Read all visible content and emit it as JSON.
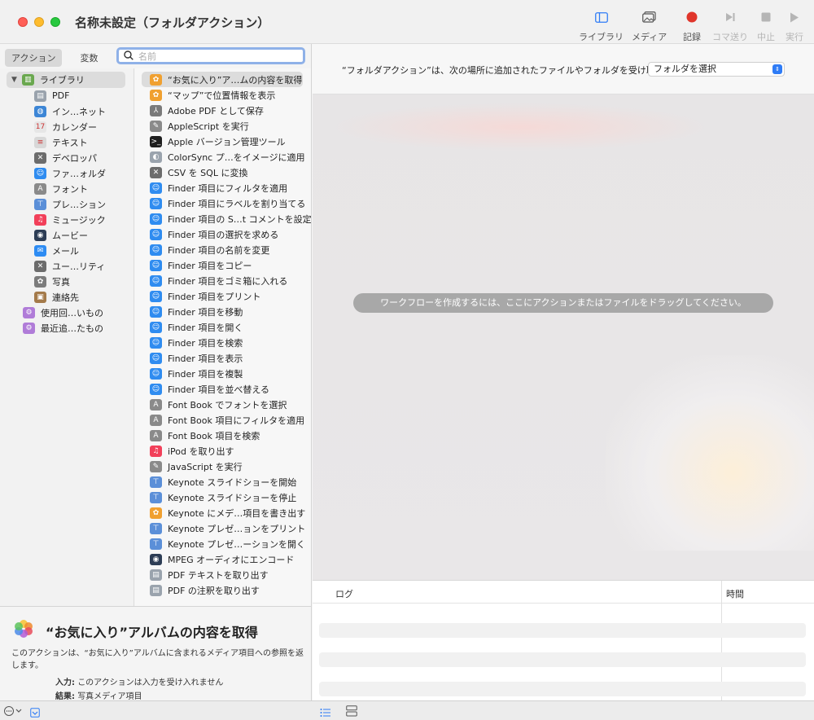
{
  "window": {
    "title": "名称未設定（フォルダアクション）"
  },
  "toolbar": {
    "library": "ライブラリ",
    "media": "メディア",
    "record": "記録",
    "step": "コマ送り",
    "stop": "中止",
    "run": "実行"
  },
  "tabs": {
    "actions": "アクション",
    "variables": "変数"
  },
  "search": {
    "placeholder": "名前"
  },
  "library": {
    "root": "ライブラリ",
    "items": [
      {
        "label": "PDF",
        "icon": "pdf-icon",
        "color": "#9aa3ad"
      },
      {
        "label": "イン…ネット",
        "icon": "globe-icon",
        "color": "#3d86d6"
      },
      {
        "label": "カレンダー",
        "icon": "calendar-icon",
        "color": "#e6e6e6"
      },
      {
        "label": "テキスト",
        "icon": "text-icon",
        "color": "#d8d8d8"
      },
      {
        "label": "デベロッパ",
        "icon": "tools-icon",
        "color": "#6c6c6c"
      },
      {
        "label": "ファ…ォルダ",
        "icon": "finder-icon",
        "color": "#2f8cf0"
      },
      {
        "label": "フォント",
        "icon": "font-icon",
        "color": "#8a8a8a"
      },
      {
        "label": "プレ…ション",
        "icon": "keynote-icon",
        "color": "#5b8fd8"
      },
      {
        "label": "ミュージック",
        "icon": "music-icon",
        "color": "#f2405a"
      },
      {
        "label": "ムービー",
        "icon": "quicktime-icon",
        "color": "#2d3d55"
      },
      {
        "label": "メール",
        "icon": "mail-icon",
        "color": "#2e8cf3"
      },
      {
        "label": "ユー…リティ",
        "icon": "utility-icon",
        "color": "#6c6c6c"
      },
      {
        "label": "写真",
        "icon": "photos-icon",
        "color": "#7c7c7c"
      },
      {
        "label": "連絡先",
        "icon": "contacts-icon",
        "color": "#a47a4a"
      }
    ],
    "smart": [
      {
        "label": "使用回…いもの",
        "icon": "smart-folder-icon",
        "color": "#b07cd8"
      },
      {
        "label": "最近追…たもの",
        "icon": "smart-folder-icon",
        "color": "#b07cd8"
      }
    ]
  },
  "actions": [
    {
      "label": "“お気に入り”ア…ムの内容を取得",
      "icon": "photos-icon",
      "color": "#f0a030",
      "selected": true
    },
    {
      "label": "“マップ”で位置情報を表示",
      "icon": "photos-icon",
      "color": "#f0a030"
    },
    {
      "label": "Adobe PDF として保存",
      "icon": "acrobat-icon",
      "color": "#7a7a7a"
    },
    {
      "label": "AppleScript を実行",
      "icon": "script-icon",
      "color": "#8a8a8a"
    },
    {
      "label": "Apple バージョン管理ツール",
      "icon": "terminal-icon",
      "color": "#1e1e1e"
    },
    {
      "label": "ColorSync プ…をイメージに適用",
      "icon": "colorsync-icon",
      "color": "#9aa3ad"
    },
    {
      "label": "CSV を SQL に変換",
      "icon": "tools-icon",
      "color": "#6c6c6c"
    },
    {
      "label": "Finder 項目にフィルタを適用",
      "icon": "finder-icon",
      "color": "#2f8cf0"
    },
    {
      "label": "Finder 項目にラベルを割り当てる",
      "icon": "finder-icon",
      "color": "#2f8cf0"
    },
    {
      "label": "Finder 項目の S…t コメントを設定",
      "icon": "finder-icon",
      "color": "#2f8cf0"
    },
    {
      "label": "Finder 項目の選択を求める",
      "icon": "finder-icon",
      "color": "#2f8cf0"
    },
    {
      "label": "Finder 項目の名前を変更",
      "icon": "finder-icon",
      "color": "#2f8cf0"
    },
    {
      "label": "Finder 項目をコピー",
      "icon": "finder-icon",
      "color": "#2f8cf0"
    },
    {
      "label": "Finder 項目をゴミ箱に入れる",
      "icon": "finder-icon",
      "color": "#2f8cf0"
    },
    {
      "label": "Finder 項目をプリント",
      "icon": "finder-icon",
      "color": "#2f8cf0"
    },
    {
      "label": "Finder 項目を移動",
      "icon": "finder-icon",
      "color": "#2f8cf0"
    },
    {
      "label": "Finder 項目を開く",
      "icon": "finder-icon",
      "color": "#2f8cf0"
    },
    {
      "label": "Finder 項目を検索",
      "icon": "finder-icon",
      "color": "#2f8cf0"
    },
    {
      "label": "Finder 項目を表示",
      "icon": "finder-icon",
      "color": "#2f8cf0"
    },
    {
      "label": "Finder 項目を複製",
      "icon": "finder-icon",
      "color": "#2f8cf0"
    },
    {
      "label": "Finder 項目を並べ替える",
      "icon": "finder-icon",
      "color": "#2f8cf0"
    },
    {
      "label": "Font Book でフォントを選択",
      "icon": "font-icon",
      "color": "#8a8a8a"
    },
    {
      "label": "Font Book 項目にフィルタを適用",
      "icon": "font-icon",
      "color": "#8a8a8a"
    },
    {
      "label": "Font Book 項目を検索",
      "icon": "font-icon",
      "color": "#8a8a8a"
    },
    {
      "label": "iPod を取り出す",
      "icon": "music-icon",
      "color": "#f2405a"
    },
    {
      "label": "JavaScript を実行",
      "icon": "script-icon",
      "color": "#8a8a8a"
    },
    {
      "label": "Keynote スライドショーを開始",
      "icon": "keynote-icon",
      "color": "#5b8fd8"
    },
    {
      "label": "Keynote スライドショーを停止",
      "icon": "keynote-icon",
      "color": "#5b8fd8"
    },
    {
      "label": "Keynote にメデ…項目を書き出す",
      "icon": "photos-icon",
      "color": "#f0a030"
    },
    {
      "label": "Keynote プレゼ…ョンをプリント",
      "icon": "keynote-icon",
      "color": "#5b8fd8"
    },
    {
      "label": "Keynote プレゼ…ーションを開く",
      "icon": "keynote-icon",
      "color": "#5b8fd8"
    },
    {
      "label": "MPEG オーディオにエンコード",
      "icon": "quicktime-icon",
      "color": "#2d3d55"
    },
    {
      "label": "PDF テキストを取り出す",
      "icon": "pdf-icon",
      "color": "#9aa3ad"
    },
    {
      "label": "PDF の注釈を取り出す",
      "icon": "pdf-icon",
      "color": "#9aa3ad"
    }
  ],
  "description": {
    "title": "“お気に入り”アルバムの内容を取得",
    "text": "このアクションは、“お気に入り”アルバムに含まれるメディア項目への参照を返します。",
    "input_label": "入力:",
    "input_value": "このアクションは入力を受け入れません",
    "result_label": "結果:",
    "result_value": "写真メディア項目"
  },
  "workflow": {
    "receive_label": "“フォルダアクション”は、次の場所に追加されたファイルやフォルダを受け取る:",
    "folder_select": "フォルダを選択",
    "drop_hint": "ワークフローを作成するには、ここにアクションまたはファイルをドラッグしてください。"
  },
  "log": {
    "col_log": "ログ",
    "col_time": "時間"
  },
  "colors": {
    "accent": "#2f7cf6",
    "record": "#e0352b"
  }
}
